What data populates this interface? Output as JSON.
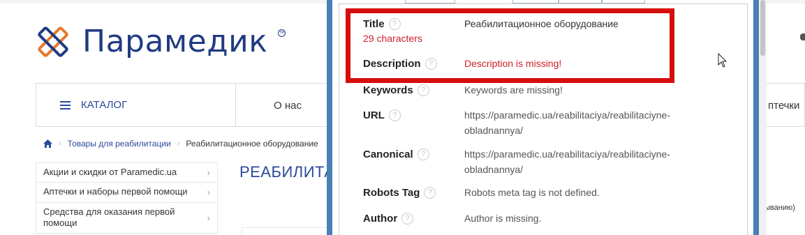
{
  "site": {
    "logo_text": "Парамедик",
    "logo_tm": "TM",
    "nav": {
      "catalog_label": "КАТАЛОГ",
      "about_label": "О нас",
      "right_label": "птечки"
    },
    "breadcrumb": {
      "items": [
        "Товары для реабилитации",
        "Реабилитационное оборудование"
      ]
    },
    "sidebar": {
      "items": [
        "Акции и скидки от Paramedic.ua",
        "Аптечки и наборы первой помощи",
        "Средства для оказания первой помощи"
      ]
    },
    "page_heading": "РЕАБИЛИТА",
    "sort_text": "ыванию)"
  },
  "seo_panel": {
    "title": {
      "label": "Title",
      "value": "Реабилитационное оборудование",
      "char_count": "29 characters"
    },
    "description": {
      "label": "Description",
      "value": "Description is missing!"
    },
    "keywords": {
      "label": "Keywords",
      "value": "Keywords are missing!"
    },
    "url": {
      "label": "URL",
      "value_line1": "https://paramedic.ua/reabilitaciya/reabilitaciyne-",
      "value_line2": "obladnannya/"
    },
    "canonical": {
      "label": "Canonical",
      "value_line1": "https://paramedic.ua/reabilitaciya/reabilitaciyne-",
      "value_line2": "obladnannya/"
    },
    "robots": {
      "label": "Robots Tag",
      "value": "Robots meta tag is not defined."
    },
    "author": {
      "label": "Author",
      "value": "Author is missing."
    },
    "help_glyph": "?"
  },
  "colors": {
    "brand_blue": "#2b4a9a",
    "logo_orange": "#e8782d",
    "panel_border": "#4a80b5",
    "highlight_red": "#d60d0d",
    "error_red": "#d0202a"
  },
  "icons": {
    "home": "home-icon",
    "menu": "hamburger-icon",
    "help": "help-circle-icon",
    "cursor": "mouse-cursor-icon"
  }
}
